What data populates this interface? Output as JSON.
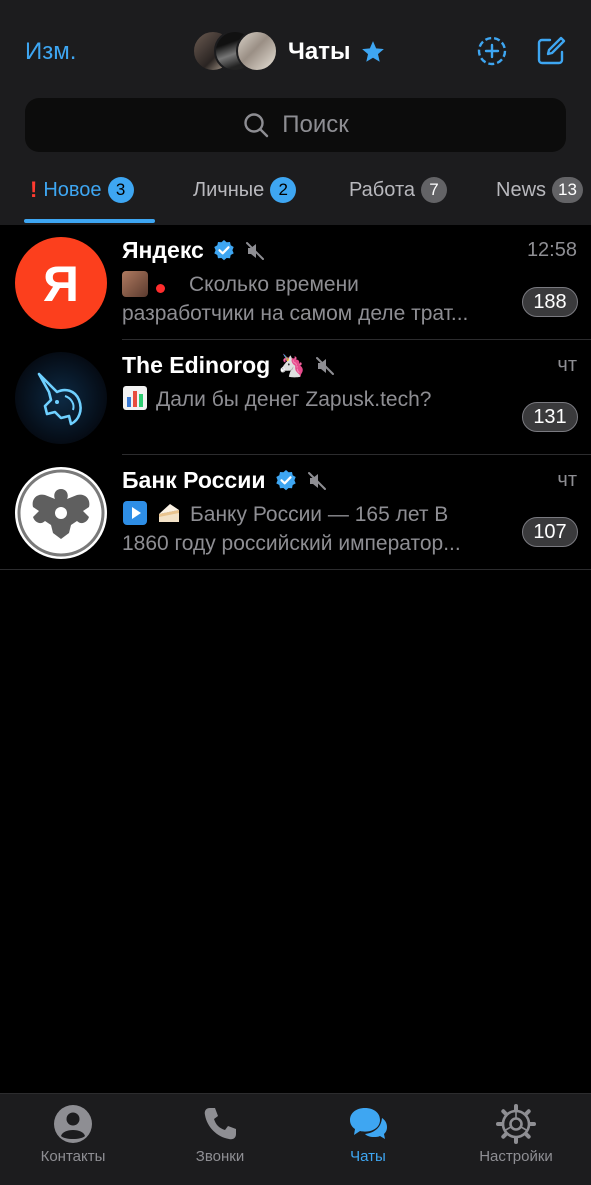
{
  "header": {
    "edit_label": "Изм.",
    "title": "Чаты"
  },
  "search": {
    "placeholder": "Поиск"
  },
  "folders": [
    {
      "label": "Новое",
      "badge": "3",
      "active": true
    },
    {
      "label": "Личные",
      "badge": "2"
    },
    {
      "label": "Работа",
      "badge": "7"
    },
    {
      "label": "News",
      "badge": "13"
    }
  ],
  "chats": [
    {
      "name": "Яндекс",
      "time": "12:58",
      "preview_line1": "Сколько времени",
      "preview_line2": "разработчики на самом деле трат...",
      "unread": "188",
      "verified": true,
      "muted": true
    },
    {
      "name": "The Edinorog",
      "time": "чт",
      "preview_line1": "Дали бы денег Zapusk.tech?",
      "preview_line2": "",
      "unread": "131",
      "muted": true
    },
    {
      "name": "Банк России",
      "time": "чт",
      "preview_line1": "Банку России — 165 лет В",
      "preview_line2": "1860 году российский император...",
      "unread": "107",
      "verified": true,
      "muted": true
    }
  ],
  "tabbar": [
    {
      "label": "Контакты",
      "icon": "person-circle-icon"
    },
    {
      "label": "Звонки",
      "icon": "phone-icon"
    },
    {
      "label": "Чаты",
      "icon": "chat-bubbles-icon",
      "active": true
    },
    {
      "label": "Настройки",
      "icon": "gear-icon"
    }
  ],
  "colors": {
    "accent": "#3ea6f2",
    "background": "#000000",
    "bar": "#1c1c1e"
  }
}
